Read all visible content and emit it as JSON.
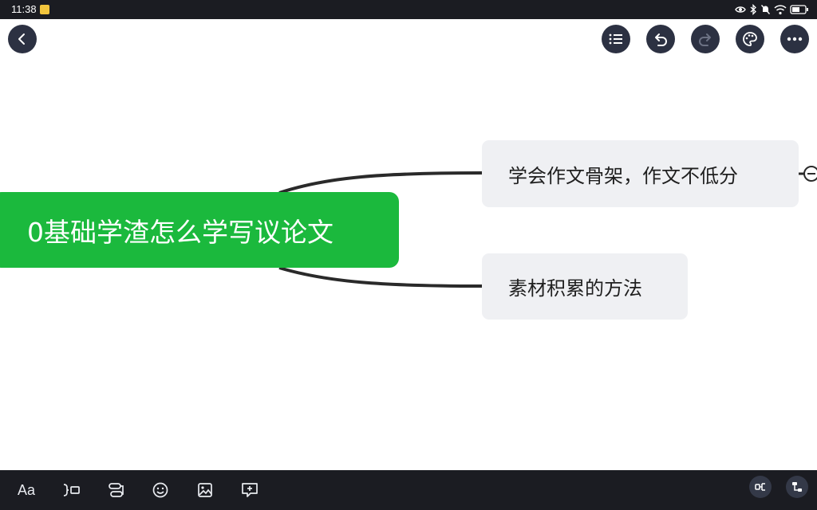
{
  "status_bar": {
    "time": "11:38",
    "icons": [
      "note-icon",
      "eye-icon",
      "bluetooth-icon",
      "mute-icon",
      "wifi-icon",
      "battery-icon"
    ]
  },
  "top_actions": {
    "back": "back-icon",
    "right": [
      "outline-list-icon",
      "undo-icon",
      "redo-icon",
      "palette-icon",
      "more-icon"
    ]
  },
  "mind_map": {
    "root": {
      "label": "0基础学渣怎么学写议论文"
    },
    "children": [
      {
        "label": "学会作文骨架，作文不低分",
        "collapsed": true
      },
      {
        "label": "素材积累的方法"
      }
    ]
  },
  "bottom_toolbar": {
    "text_style_label": "Aa",
    "tools": [
      "add-summary-icon",
      "relationship-icon",
      "emoji-icon",
      "image-icon",
      "comment-icon"
    ],
    "right": [
      "structure-icon",
      "layout-icon"
    ]
  },
  "colors": {
    "root_fill": "#1bb93d",
    "node_fill": "#eff0f3",
    "toolbar_bg": "#1b1c22",
    "button_bg": "#2c3142"
  }
}
